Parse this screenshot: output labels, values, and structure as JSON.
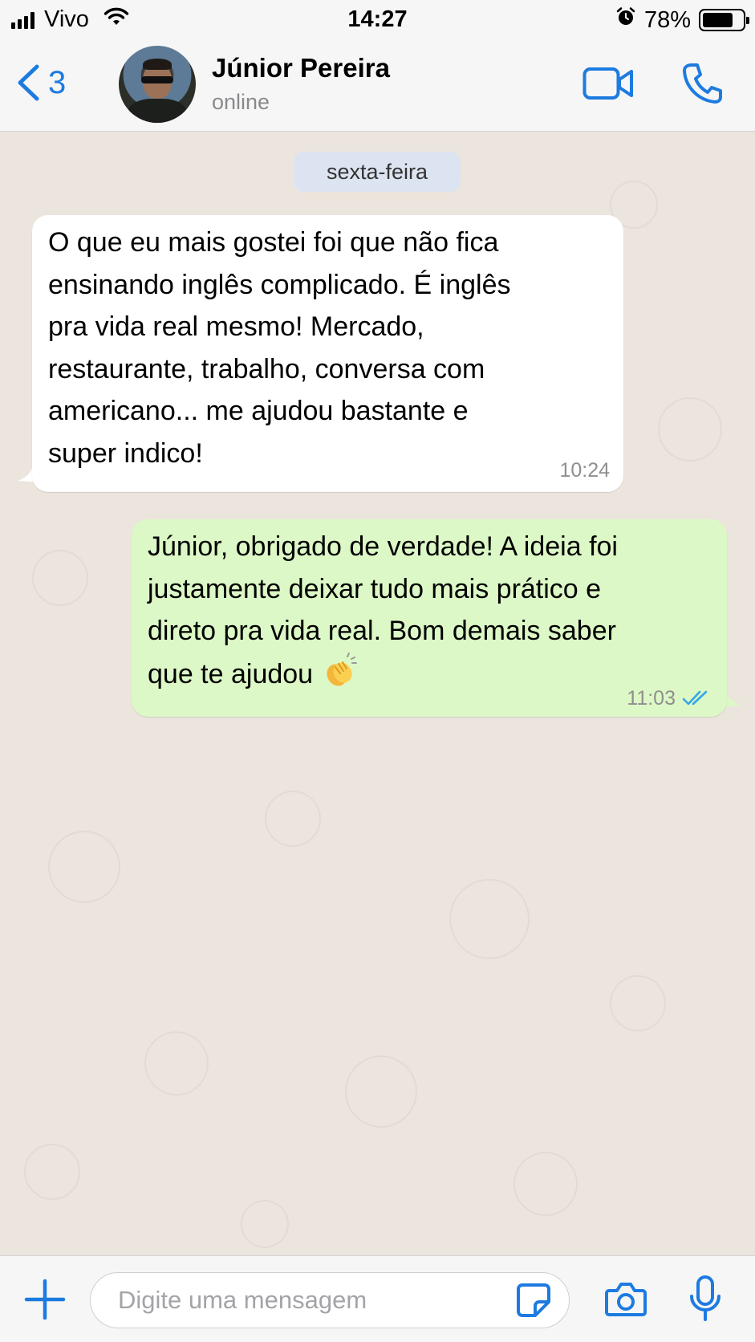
{
  "status_bar": {
    "carrier": "Vivo",
    "time": "14:27",
    "battery_percent": "78%",
    "battery_level": 0.78,
    "icons": [
      "signal-icon",
      "wifi-icon",
      "alarm-icon",
      "battery-icon"
    ]
  },
  "header": {
    "back_count": "3",
    "contact_name": "Júnior Pereira",
    "contact_status": "online",
    "icons": [
      "back-chevron-icon",
      "video-call-icon",
      "phone-call-icon"
    ],
    "accent_color": "#1d7be0"
  },
  "chat": {
    "date_label": "sexta-feira",
    "messages": [
      {
        "direction": "incoming",
        "text": "O que eu mais gostei foi que não fica\nensinando inglês complicado. É inglês\npra vida real mesmo! Mercado,\nrestaurante, trabalho, conversa com\namericano... me ajudou bastante e\nsuper indico!",
        "time": "10:24"
      },
      {
        "direction": "outgoing",
        "text": "Júnior, obrigado de verdade! A ideia foi\njustamente deixar tudo mais prático e\ndireto pra vida real. Bom demais saber\nque te ajudou",
        "emoji": "clapping-hands-emoji",
        "time": "11:03",
        "status": "read"
      }
    ],
    "incoming_bubble_color": "#ffffff",
    "outgoing_bubble_color": "#dcf8c6",
    "read_tick_color": "#34a7e8"
  },
  "input_bar": {
    "placeholder": "Digite uma mensagem",
    "value": "",
    "icons": [
      "plus-icon",
      "sticker-icon",
      "camera-icon",
      "microphone-icon"
    ]
  }
}
